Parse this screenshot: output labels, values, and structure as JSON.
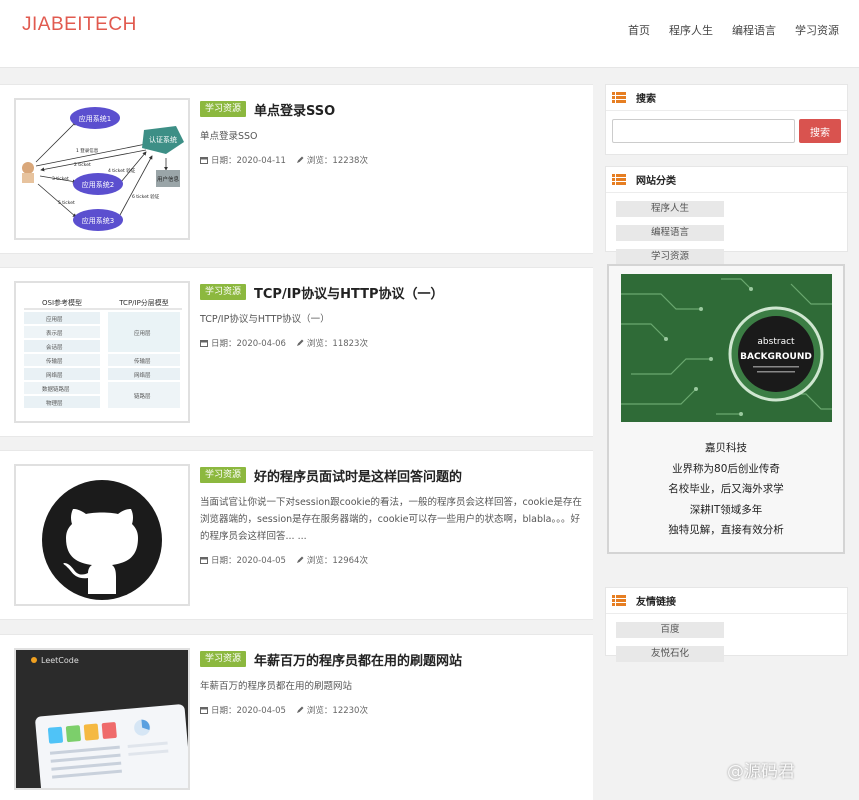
{
  "header": {
    "logo": "JIABEITECH",
    "nav": [
      "首页",
      "程序人生",
      "编程语言",
      "学习资源"
    ]
  },
  "articles": [
    {
      "tag": "学习资源",
      "title": "单点登录SSO",
      "summary": "单点登录SSO",
      "date": "日期：2020-04-11",
      "views": "浏览：12238次",
      "thumb": {
        "nodes": [
          "应用系统1",
          "应用系统2",
          "应用系统3",
          "认证系统",
          "用户信息"
        ],
        "edges": [
          "1 登录信息",
          "2 ticket",
          "3 ticket",
          "4 ticket 验证",
          "5 ticket",
          "6 ticket 验证"
        ]
      }
    },
    {
      "tag": "学习资源",
      "title": "TCP/IP协议与HTTP协议（一）",
      "summary": "TCP/IP协议与HTTP协议（一）",
      "date": "日期：2020-04-06",
      "views": "浏览：11823次",
      "thumb": {
        "left_header": "OSI参考模型",
        "right_header": "TCP/IP分层模型",
        "left_rows": [
          "应用层",
          "表示层",
          "会话层",
          "传输层",
          "网络层",
          "数据链路层",
          "物理层"
        ],
        "right_rows": [
          "应用层",
          "传输层",
          "网络层",
          "链路层"
        ]
      }
    },
    {
      "tag": "学习资源",
      "title": "好的程序员面试时是这样回答问题的",
      "summary": "当面试官让你说一下对session跟cookie的看法，一般的程序员会这样回答，cookie是存在浏览器端的，session是存在服务器端的，cookie可以存一些用户的状态啊，blabla。。。好的程序员会这样回答... ...",
      "date": "日期：2020-04-05",
      "views": "浏览：12964次"
    },
    {
      "tag": "学习资源",
      "title": "年薪百万的程序员都在用的刷题网站",
      "summary": "年薪百万的程序员都在用的刷题网站",
      "date": "日期：2020-04-05",
      "views": "浏览：12230次",
      "thumb": {
        "brand": "LeetCode"
      }
    }
  ],
  "sidebar": {
    "search": {
      "title": "搜索",
      "placeholder": "",
      "button": "搜索"
    },
    "categories": {
      "title": "网站分类",
      "items": [
        "程序人生",
        "编程语言",
        "学习资源"
      ]
    },
    "ad": {
      "image_text_1": "abstract",
      "image_text_2": "BACKGROUND",
      "lines": [
        "嘉贝科技",
        "业界称为80后创业传奇",
        "名校毕业，后又海外求学",
        "深耕IT领域多年",
        "独特见解，直接有效分析"
      ]
    },
    "links": {
      "title": "友情链接",
      "items": [
        "百度",
        "友悦石化"
      ]
    }
  },
  "watermark": "@源码君",
  "colors": {
    "accent": "#e15a4f",
    "tag": "#8cb83f",
    "search_button": "#d9534f",
    "widget_icon": "#e67e22"
  }
}
